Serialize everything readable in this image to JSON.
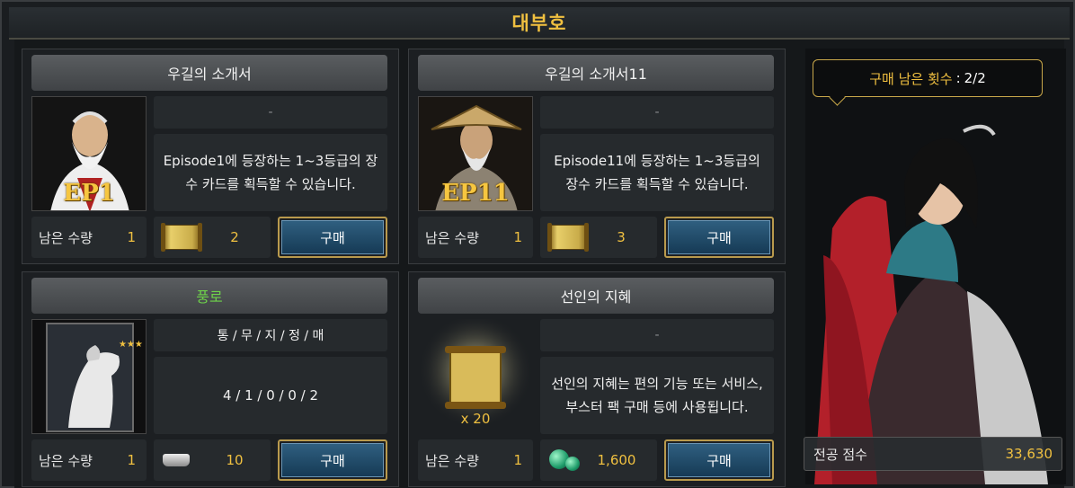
{
  "window": {
    "title": "대부호"
  },
  "cards": [
    {
      "title": "우길의 소개서",
      "sub": "-",
      "desc": "Episode1에 등장하는 1~3등급의 장수 카드를 획득할 수 있습니다.",
      "badge": "EP1",
      "remain_label": "남은 수량",
      "remain": "1",
      "price": "2",
      "currency_icon": "scroll-icon",
      "buy_label": "구매"
    },
    {
      "title": "우길의 소개서11",
      "sub": "-",
      "desc": "Episode11에 등장하는 1~3등급의 장수 카드를 획득할 수 있습니다.",
      "badge": "EP11",
      "remain_label": "남은 수량",
      "remain": "1",
      "price": "3",
      "currency_icon": "scroll-icon",
      "buy_label": "구매"
    },
    {
      "title": "풍로",
      "sub": "통 / 무 / 지 / 정 / 매",
      "desc": "4 / 1 / 0 / 0 / 2",
      "remain_label": "남은 수량",
      "remain": "1",
      "price": "10",
      "currency_icon": "silver-ingot-icon",
      "buy_label": "구매"
    },
    {
      "title": "선인의 지혜",
      "sub": "-",
      "desc": "선인의 지혜는 편의 기능 또는 서비스, 부스터 팩 구매 등에 사용됩니다.",
      "qty_badge": "x 20",
      "remain_label": "남은 수량",
      "remain": "1",
      "price": "1,600",
      "currency_icon": "jade-icon",
      "buy_label": "구매"
    }
  ],
  "side": {
    "purchase_label": "구매 남은 횟수",
    "purchase_sep": ":",
    "purchase_value": "2/2",
    "score_label": "전공 점수",
    "score_value": "33,630"
  },
  "colors": {
    "accent_gold": "#f0c040",
    "buy_blue": "#2f5f80",
    "name_green": "#6ed34a"
  }
}
